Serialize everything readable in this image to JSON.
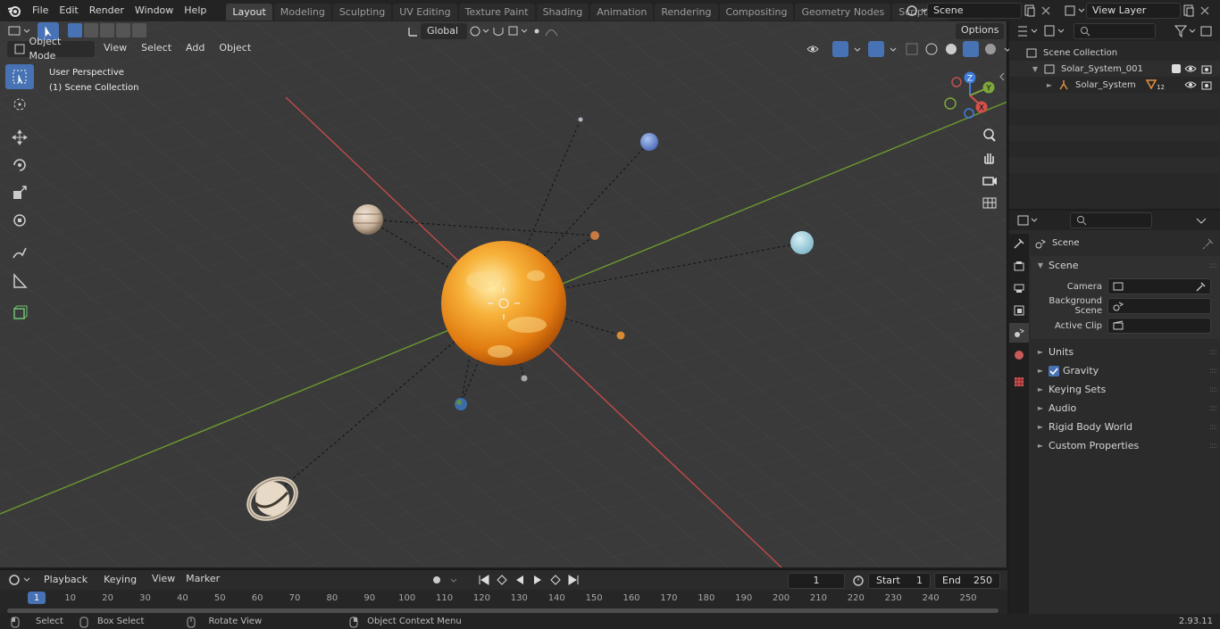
{
  "menus": [
    "File",
    "Edit",
    "Render",
    "Window",
    "Help"
  ],
  "workspaces": [
    "Layout",
    "Modeling",
    "Sculpting",
    "UV Editing",
    "Texture Paint",
    "Shading",
    "Animation",
    "Rendering",
    "Compositing",
    "Geometry Nodes",
    "Scripting"
  ],
  "active_workspace": "Layout",
  "scene_name": "Scene",
  "view_layer": "View Layer",
  "viewport": {
    "mode": "Object Mode",
    "menu": [
      "View",
      "Select",
      "Add",
      "Object"
    ],
    "transform_orientation": "Global",
    "options": "Options",
    "perspective_label": "User Perspective",
    "collection_label": "(1) Scene Collection"
  },
  "gizmo": {
    "x": "X",
    "y": "Y",
    "z": "Z"
  },
  "outliner": {
    "root": "Scene Collection",
    "items": [
      {
        "name": "Solar_System_001"
      },
      {
        "name": "Solar_System",
        "badge": "12"
      }
    ]
  },
  "properties": {
    "header": "Scene",
    "section": "Scene",
    "fields": [
      {
        "label": "Camera"
      },
      {
        "label": "Background Scene"
      },
      {
        "label": "Active Clip"
      }
    ],
    "panels": [
      "Units",
      "Gravity",
      "Keying Sets",
      "Audio",
      "Rigid Body World",
      "Custom Properties"
    ]
  },
  "timeline": {
    "menus": [
      "Playback",
      "Keying",
      "View",
      "Marker"
    ],
    "current_frame": "1",
    "start_label": "Start",
    "start": "1",
    "end_label": "End",
    "end": "250",
    "ticks": [
      "1",
      "10",
      "20",
      "30",
      "40",
      "50",
      "60",
      "70",
      "80",
      "90",
      "100",
      "110",
      "120",
      "130",
      "140",
      "150",
      "160",
      "170",
      "180",
      "190",
      "200",
      "210",
      "220",
      "230",
      "240",
      "250"
    ]
  },
  "statusbar": {
    "items": [
      "Select",
      "Box Select",
      "Rotate View",
      "Object Context Menu"
    ],
    "version": "2.93.11"
  },
  "colors": {
    "accent": "#4772b3",
    "x_axis": "#d4504a",
    "y_axis": "#7ea83a",
    "z_axis": "#3f7ddc"
  }
}
